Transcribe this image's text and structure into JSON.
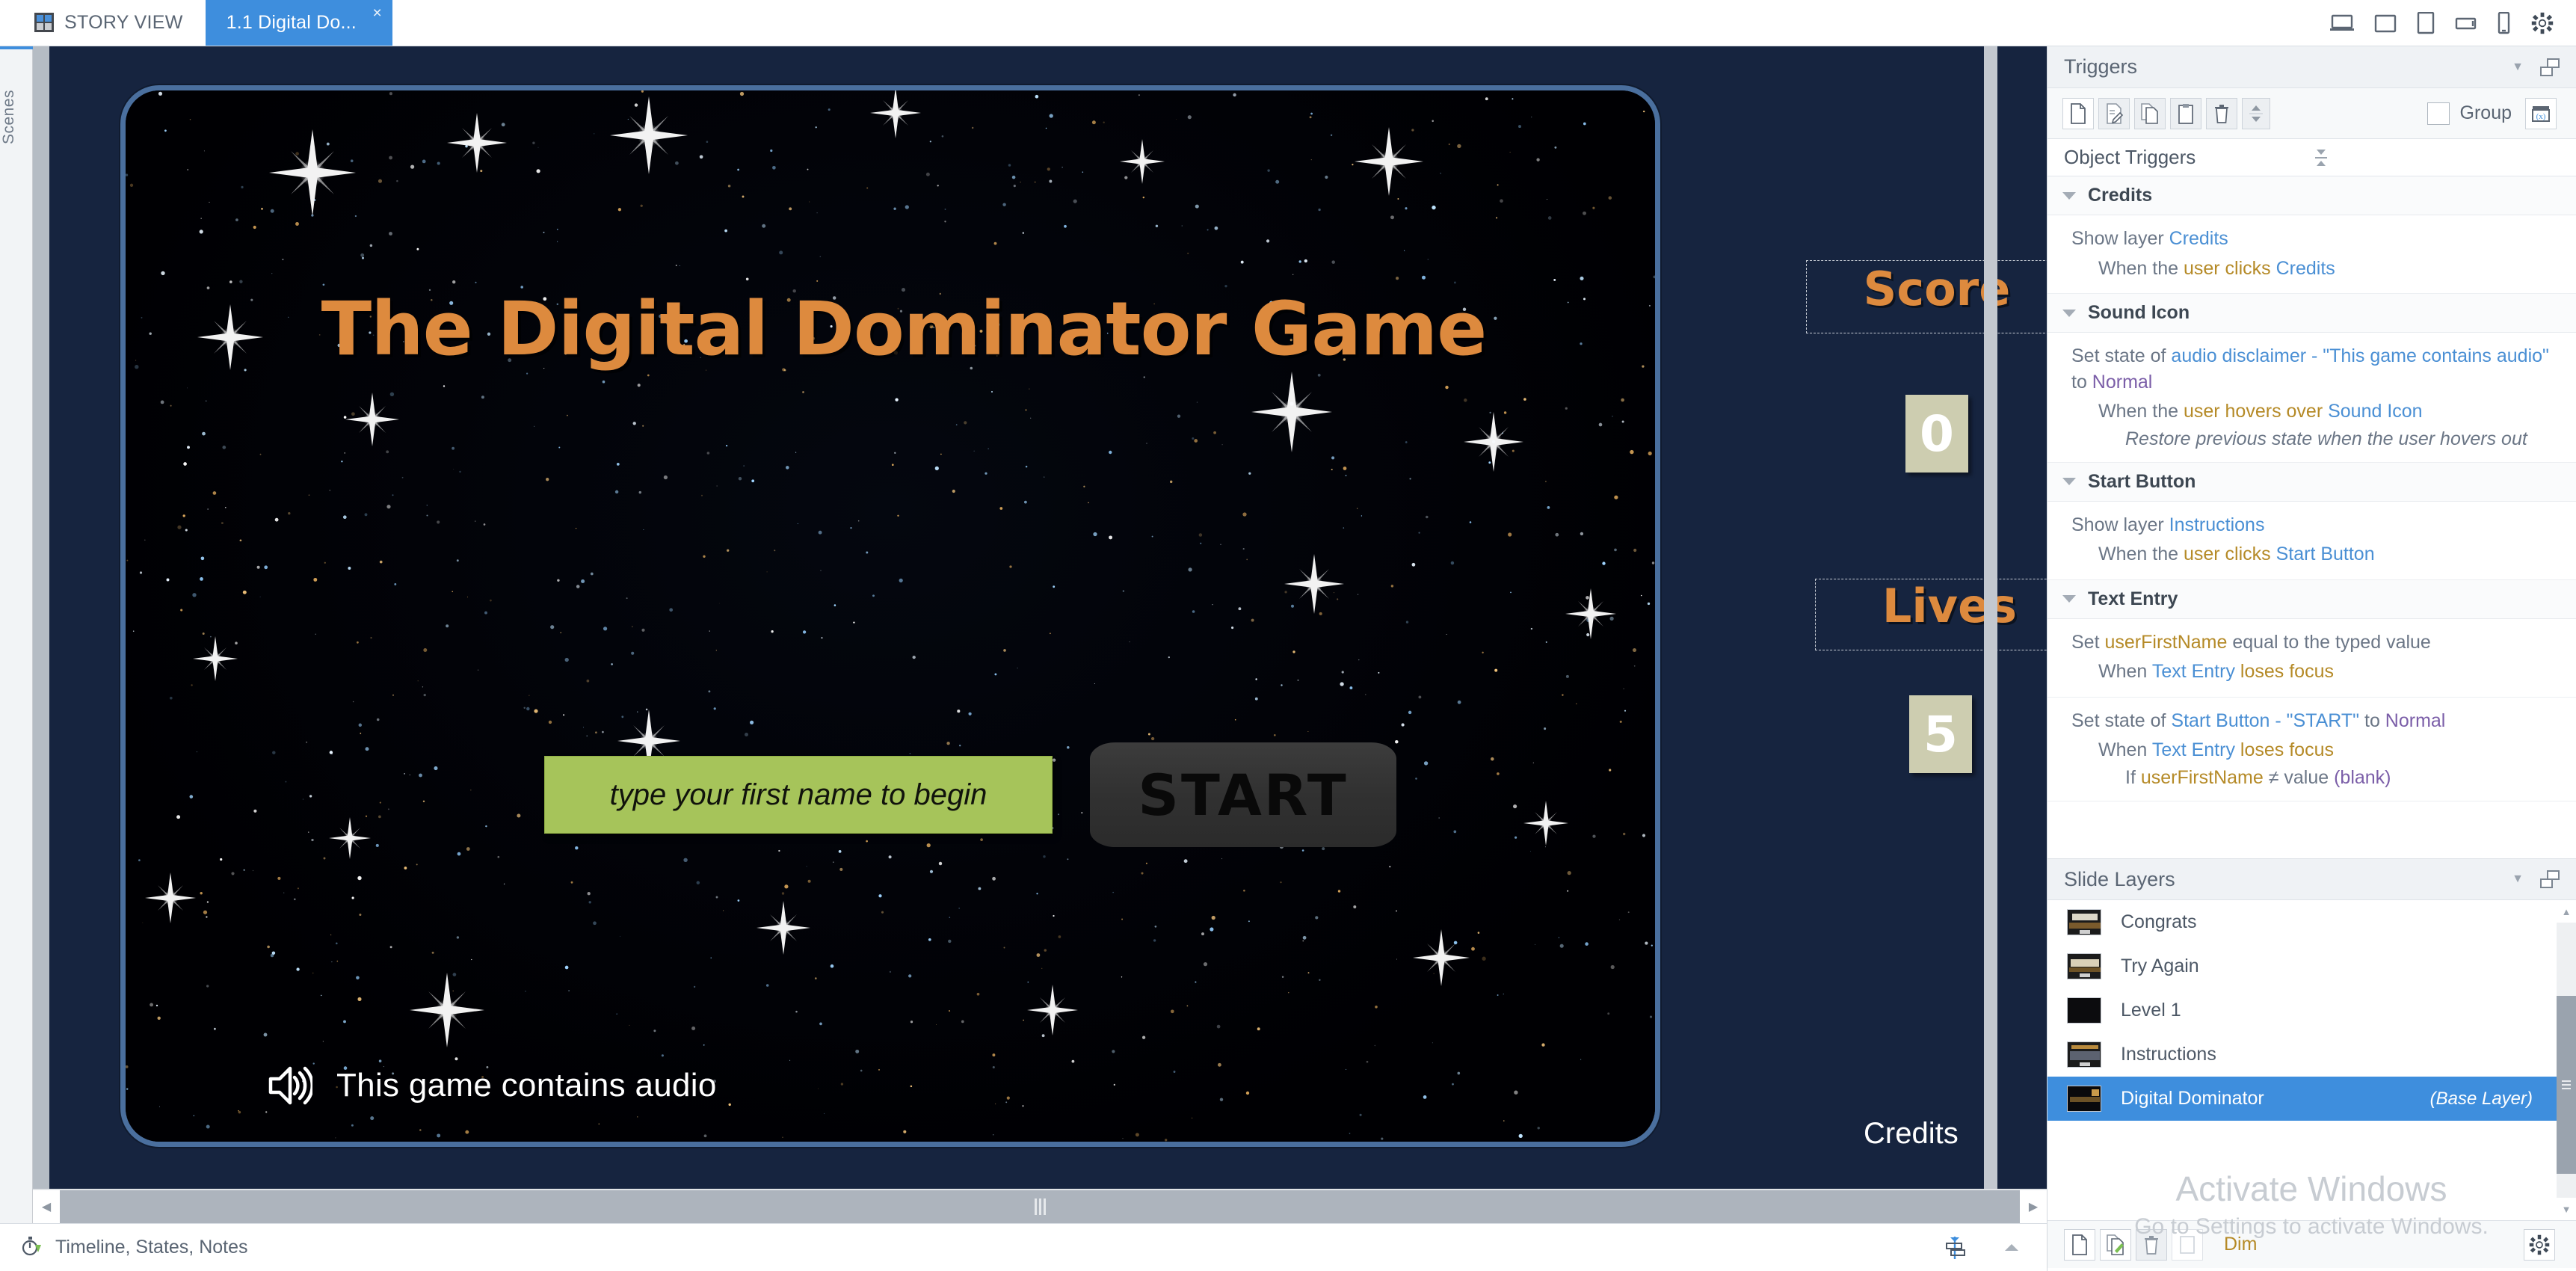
{
  "tabs": {
    "story_view": "STORY VIEW",
    "slide_tab": "1.1 Digital Do...",
    "close": "×"
  },
  "device_icons": [
    "laptop-icon",
    "tablet-landscape-icon",
    "tablet-portrait-icon",
    "phone-landscape-icon",
    "phone-portrait-icon",
    "gear-icon"
  ],
  "scenes_rail": {
    "label": "Scenes"
  },
  "slide": {
    "title": "The Digital Dominator Game",
    "text_entry_placeholder": "type your first name to begin",
    "start_button": "START",
    "audio_disclaimer": "This game contains audio",
    "credits_link": "Credits",
    "hud": {
      "score_label": "Score",
      "score_value": "0",
      "lives_label": "Lives",
      "lives_value": "5"
    },
    "colors": {
      "canvas_bg": "#16243f",
      "title_orange": "#dd8a3e",
      "entry_green": "#a6c45a",
      "hud_tile": "#cdcdb0",
      "panel_border": "#4a6f9e"
    }
  },
  "triggers_panel": {
    "title": "Triggers",
    "toolbar_icons": [
      "new-trigger-icon",
      "edit-trigger-icon",
      "copy-trigger-icon",
      "paste-trigger-icon",
      "delete-trigger-icon",
      "reorder-trigger-icon"
    ],
    "group_label": "Group",
    "variables_icon": "variables-icon",
    "section_title": "Object Triggers",
    "groups": [
      {
        "name": "Credits",
        "items": [
          {
            "action_pre": "Show layer ",
            "action_link": "Credits",
            "action_post": "",
            "when_pre": "When the ",
            "when_mid": "user clicks ",
            "when_link": "Credits",
            "when_post": ""
          }
        ]
      },
      {
        "name": "Sound Icon",
        "items": [
          {
            "action_pre": "Set state of ",
            "action_link": "audio disclaimer - \"This game contains audio\"",
            "action_mid": " to ",
            "action_state": "Normal",
            "when_pre": "When the ",
            "when_mid": "user hovers over ",
            "when_link": "Sound Icon",
            "when_post": "",
            "sub": "Restore previous state when the user hovers out"
          }
        ]
      },
      {
        "name": "Start Button",
        "items": [
          {
            "action_pre": "Show layer ",
            "action_link": "Instructions",
            "action_post": "",
            "when_pre": "When the ",
            "when_mid": "user clicks ",
            "when_link": "Start Button",
            "when_post": ""
          }
        ]
      },
      {
        "name": "Text Entry",
        "items": [
          {
            "action_pre": "Set ",
            "action_var": "userFirstName",
            "action_post": " equal to the typed value",
            "when_pre": "When ",
            "when_link": "Text Entry",
            "when_mid": " loses focus",
            "when_post": ""
          },
          {
            "action_pre": "Set state of ",
            "action_link": "Start Button - \"START\"",
            "action_mid": " to ",
            "action_state": "Normal",
            "when_pre": "When ",
            "when_link": "Text Entry",
            "when_mid": " loses focus",
            "when_post": "",
            "cond_pre": "If ",
            "cond_var": "userFirstName",
            "cond_mid": " ≠ value ",
            "cond_state": "(blank)"
          }
        ]
      }
    ]
  },
  "slide_layers_panel": {
    "title": "Slide Layers",
    "layers": [
      {
        "name": "Congrats",
        "badge": ""
      },
      {
        "name": "Try Again",
        "badge": ""
      },
      {
        "name": "Level 1",
        "badge": ""
      },
      {
        "name": "Instructions",
        "badge": ""
      },
      {
        "name": "Digital Dominator",
        "badge": "(Base Layer)",
        "selected": true
      }
    ],
    "toolbar_icons": [
      "new-layer-icon",
      "duplicate-layer-icon",
      "delete-layer-icon",
      "dim-layer-icon",
      "layer-settings-gear-icon"
    ],
    "dim_label": "Dim"
  },
  "statusbar": {
    "label": "Timeline, States, Notes",
    "icons": [
      "timeline-icon",
      "align-icon",
      "collapse-icon"
    ]
  },
  "watermark": {
    "line1": "Activate Windows",
    "line2": "Go to Settings to activate Windows."
  }
}
